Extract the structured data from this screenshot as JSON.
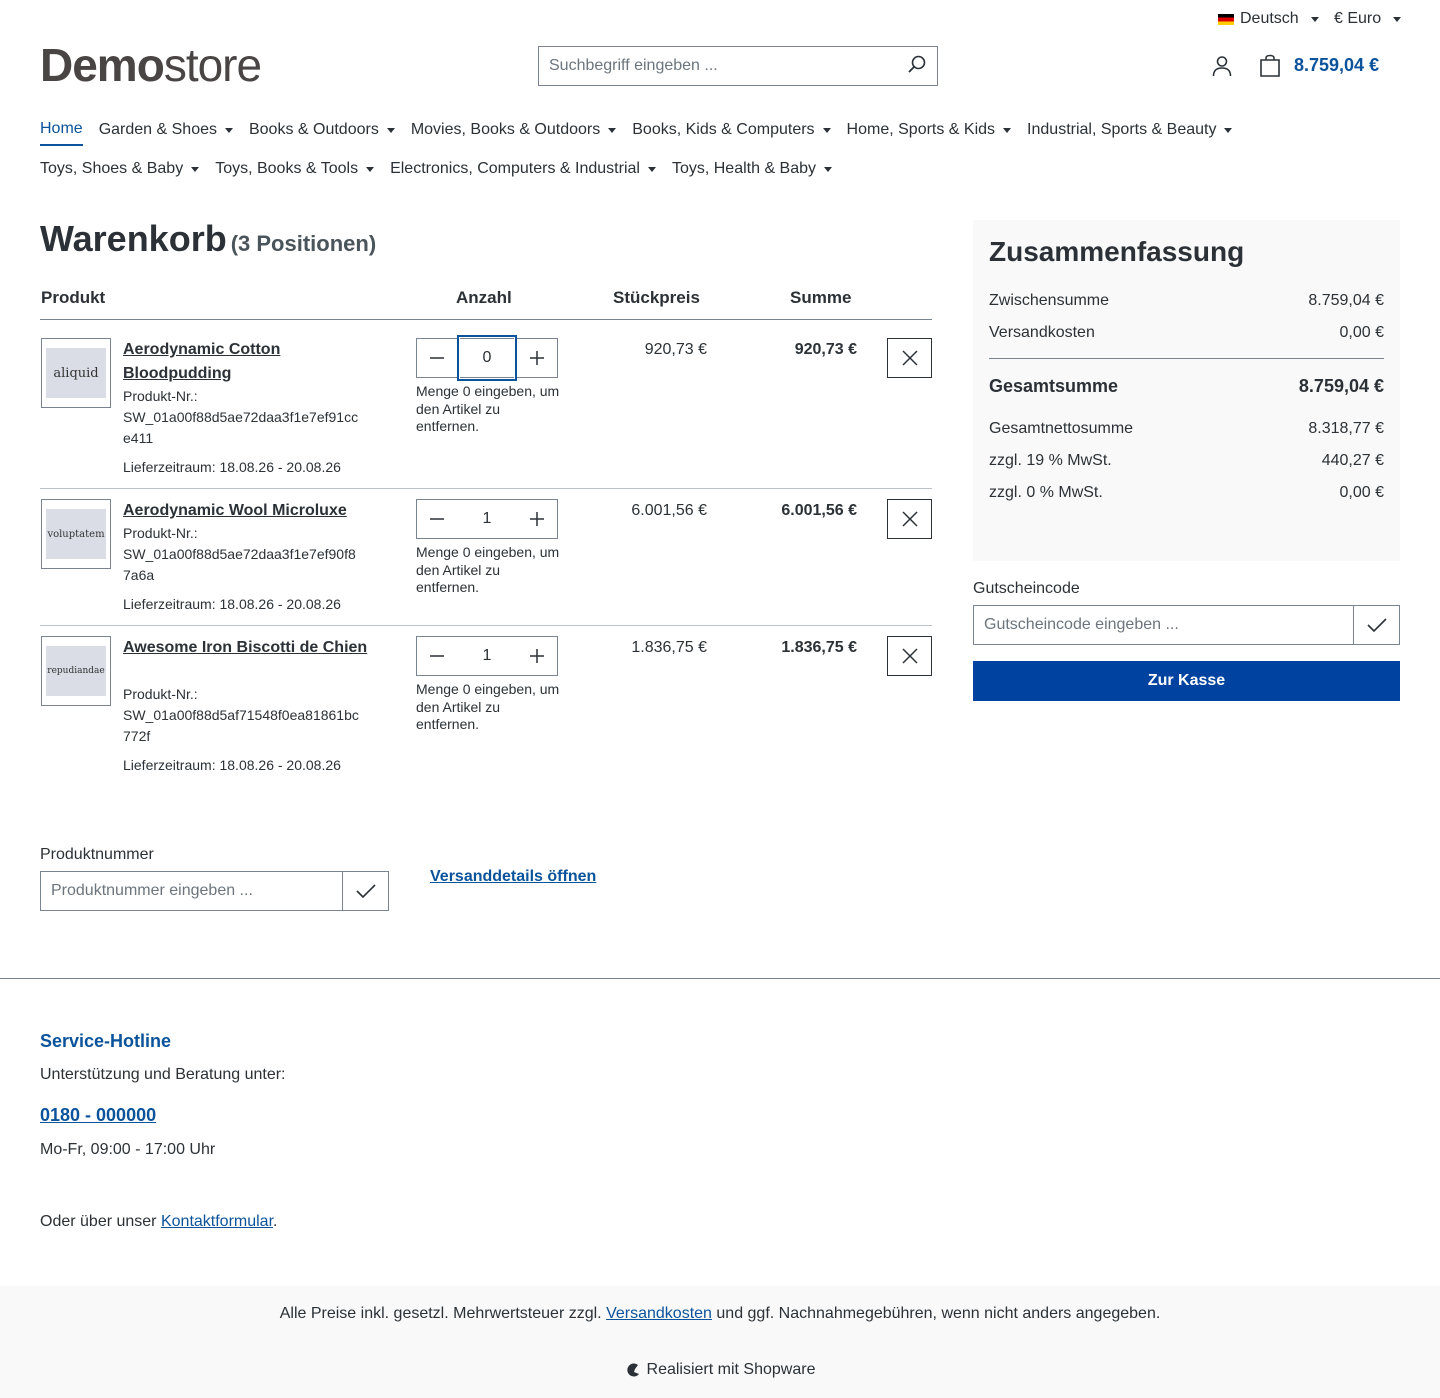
{
  "topbar": {
    "language": "Deutsch",
    "currency": "€ Euro"
  },
  "header": {
    "logo_bold": "Demo",
    "logo_light": "store",
    "search_placeholder": "Suchbegriff eingeben ...",
    "cart_total": "8.759,04 €"
  },
  "nav": {
    "row1": [
      {
        "label": "Home",
        "active": true,
        "dropdown": false
      },
      {
        "label": "Garden & Shoes",
        "dropdown": true
      },
      {
        "label": "Books & Outdoors",
        "dropdown": true
      },
      {
        "label": "Movies, Books & Outdoors",
        "dropdown": true
      },
      {
        "label": "Books, Kids & Computers",
        "dropdown": true
      },
      {
        "label": "Home, Sports & Kids",
        "dropdown": true
      },
      {
        "label": "Industrial, Sports & Beauty",
        "dropdown": true
      }
    ],
    "row2": [
      {
        "label": "Toys, Shoes & Baby",
        "dropdown": true
      },
      {
        "label": "Toys, Books & Tools",
        "dropdown": true
      },
      {
        "label": "Electronics, Computers & Industrial",
        "dropdown": true
      },
      {
        "label": "Toys, Health & Baby",
        "dropdown": true
      }
    ]
  },
  "cart": {
    "title": "Warenkorb",
    "count_label": "(3 Positionen)",
    "columns": {
      "product": "Produkt",
      "quantity": "Anzahl",
      "unit_price": "Stückpreis",
      "total": "Summe"
    },
    "items": [
      {
        "thumb_text": "aliquid",
        "name": "Aerodynamic Cotton Bloodpudding",
        "number_label": "Produkt-Nr.:",
        "number": "SW_01a00f88d5ae72daa3f1e7ef91cce411",
        "delivery": "Lieferzeitraum: 18.08.26 - 20.08.26",
        "quantity": "0",
        "qty_hint": "Menge 0 eingeben, um den Artikel zu entfernen.",
        "unit_price": "920,73 €",
        "total": "920,73 €"
      },
      {
        "thumb_text": "voluptatem",
        "name": "Aerodynamic Wool Microluxe",
        "number_label": "Produkt-Nr.:",
        "number": "SW_01a00f88d5ae72daa3f1e7ef90f87a6a",
        "delivery": "Lieferzeitraum: 18.08.26 - 20.08.26",
        "quantity": "1",
        "qty_hint": "Menge 0 eingeben, um den Artikel zu entfernen.",
        "unit_price": "6.001,56 €",
        "total": "6.001,56 €"
      },
      {
        "thumb_text": "repudiandae",
        "name": "Awesome Iron Biscotti de Chien",
        "number_label": "Produkt-Nr.:",
        "number": "SW_01a00f88d5af71548f0ea81861bc772f",
        "delivery": "Lieferzeitraum: 18.08.26 - 20.08.26",
        "quantity": "1",
        "qty_hint": "Menge 0 eingeben, um den Artikel zu entfernen.",
        "unit_price": "1.836,75 €",
        "total": "1.836,75 €"
      }
    ],
    "product_number_label": "Produktnummer",
    "product_number_placeholder": "Produktnummer eingeben ...",
    "shipping_link": "Versanddetails öffnen"
  },
  "summary": {
    "title": "Zusammenfassung",
    "subtotal_label": "Zwischensumme",
    "subtotal": "8.759,04 €",
    "shipping_label": "Versandkosten",
    "shipping": "0,00 €",
    "total_label": "Gesamtsumme",
    "total": "8.759,04 €",
    "net_label": "Gesamtnettosumme",
    "net": "8.318,77 €",
    "tax19_label": "zzgl. 19 % MwSt.",
    "tax19": "440,27 €",
    "tax0_label": "zzgl. 0 % MwSt.",
    "tax0": "0,00 €",
    "voucher_label": "Gutscheincode",
    "voucher_placeholder": "Gutscheincode eingeben ...",
    "checkout": "Zur Kasse"
  },
  "footer": {
    "hotline_title": "Service-Hotline",
    "hotline_text": "Unterstützung und Beratung unter:",
    "phone": "0180 - 000000",
    "hours": "Mo-Fr, 09:00 - 17:00 Uhr",
    "contact_prefix": "Oder über unser",
    "contact_link": "Kontaktformular",
    "contact_suffix": ".",
    "vat_prefix": "Alle Preise inkl. gesetzl. Mehrwertsteuer zzgl.",
    "vat_link": "Versandkosten",
    "vat_suffix": "und ggf. Nachnahmegebühren, wenn nicht anders angegeben.",
    "powered": "Realisiert mit Shopware"
  },
  "colors": {
    "brand": "#0b539b",
    "checkout_bg": "#0042a0",
    "text": "#2b3136",
    "border": "#798490",
    "panel_bg": "#f9f9f9"
  }
}
